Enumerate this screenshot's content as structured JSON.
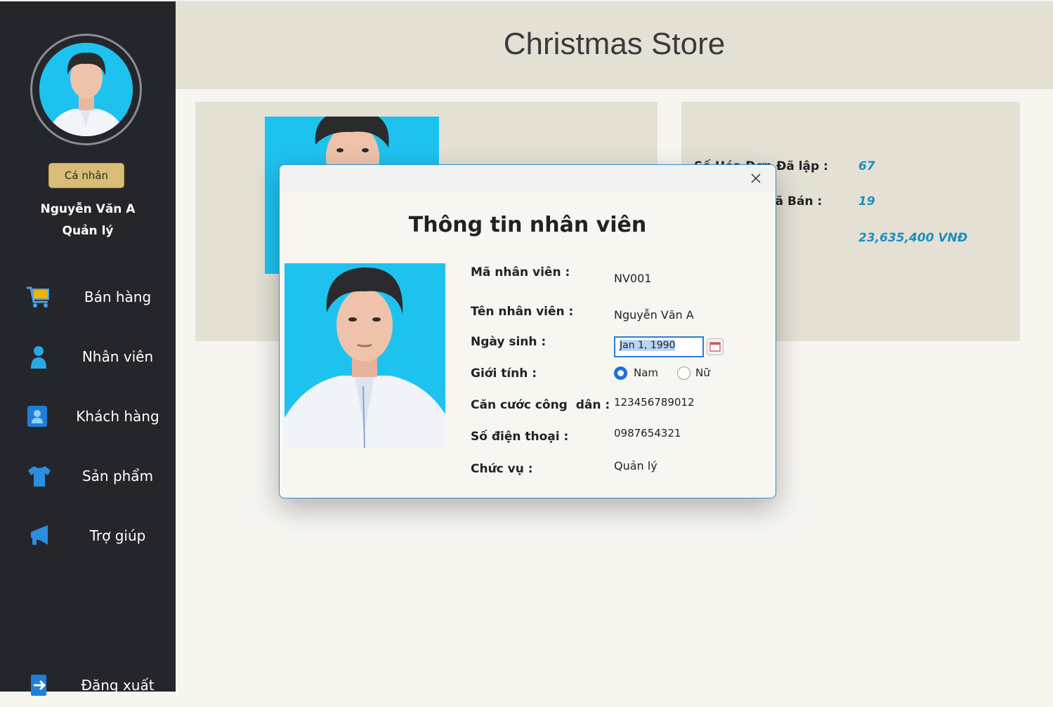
{
  "sidebar": {
    "personal_button": "Cá nhân",
    "user_name": "Nguyễn Văn A",
    "user_role": "Quản lý",
    "nav": [
      {
        "label": "Bán hàng",
        "icon": "cart-icon"
      },
      {
        "label": "Nhân viên",
        "icon": "person-icon"
      },
      {
        "label": "Khách hàng",
        "icon": "contact-card-icon"
      },
      {
        "label": "Sản phẩm",
        "icon": "shirt-icon"
      },
      {
        "label": "Trợ giúp",
        "icon": "megaphone-icon"
      },
      {
        "label": "Đăng xuất",
        "icon": "logout-icon"
      }
    ]
  },
  "header": {
    "title": "Christmas Store"
  },
  "stats": {
    "invoices_label": "Số Hóa Đơn Đã lập :",
    "invoices_value": "67",
    "sold_label": "Sản Phẩm Đã Bán :",
    "sold_value": "19",
    "revenue_value": "23,635,400 VNĐ"
  },
  "dialog": {
    "title": "Thông tin nhân viên",
    "close_icon": "close-icon",
    "fields": {
      "id_label": "Mã nhân viên :",
      "id_value": "NV001",
      "name_label": "Tên nhân viên :",
      "name_value": "Nguyễn Văn A",
      "dob_label": "Ngày sinh :",
      "dob_value": "Jan 1, 1990",
      "gender_label": "Giới tính :",
      "gender_male": "Nam",
      "gender_female": "Nữ",
      "gender_selected": "Nam",
      "cccd_label": "Căn cước công  dân :",
      "cccd_value": "123456789012",
      "phone_label": "Số điện thoại :",
      "phone_value": "0987654321",
      "position_label": "Chức vụ :",
      "position_value": "Quản lý"
    }
  },
  "colors": {
    "sidebar_bg": "#25262b",
    "header_bg": "#e4e1d4",
    "accent_button": "#d9bd75",
    "stat_value": "#1a8fbf",
    "dialog_border": "#2e8fd6"
  }
}
